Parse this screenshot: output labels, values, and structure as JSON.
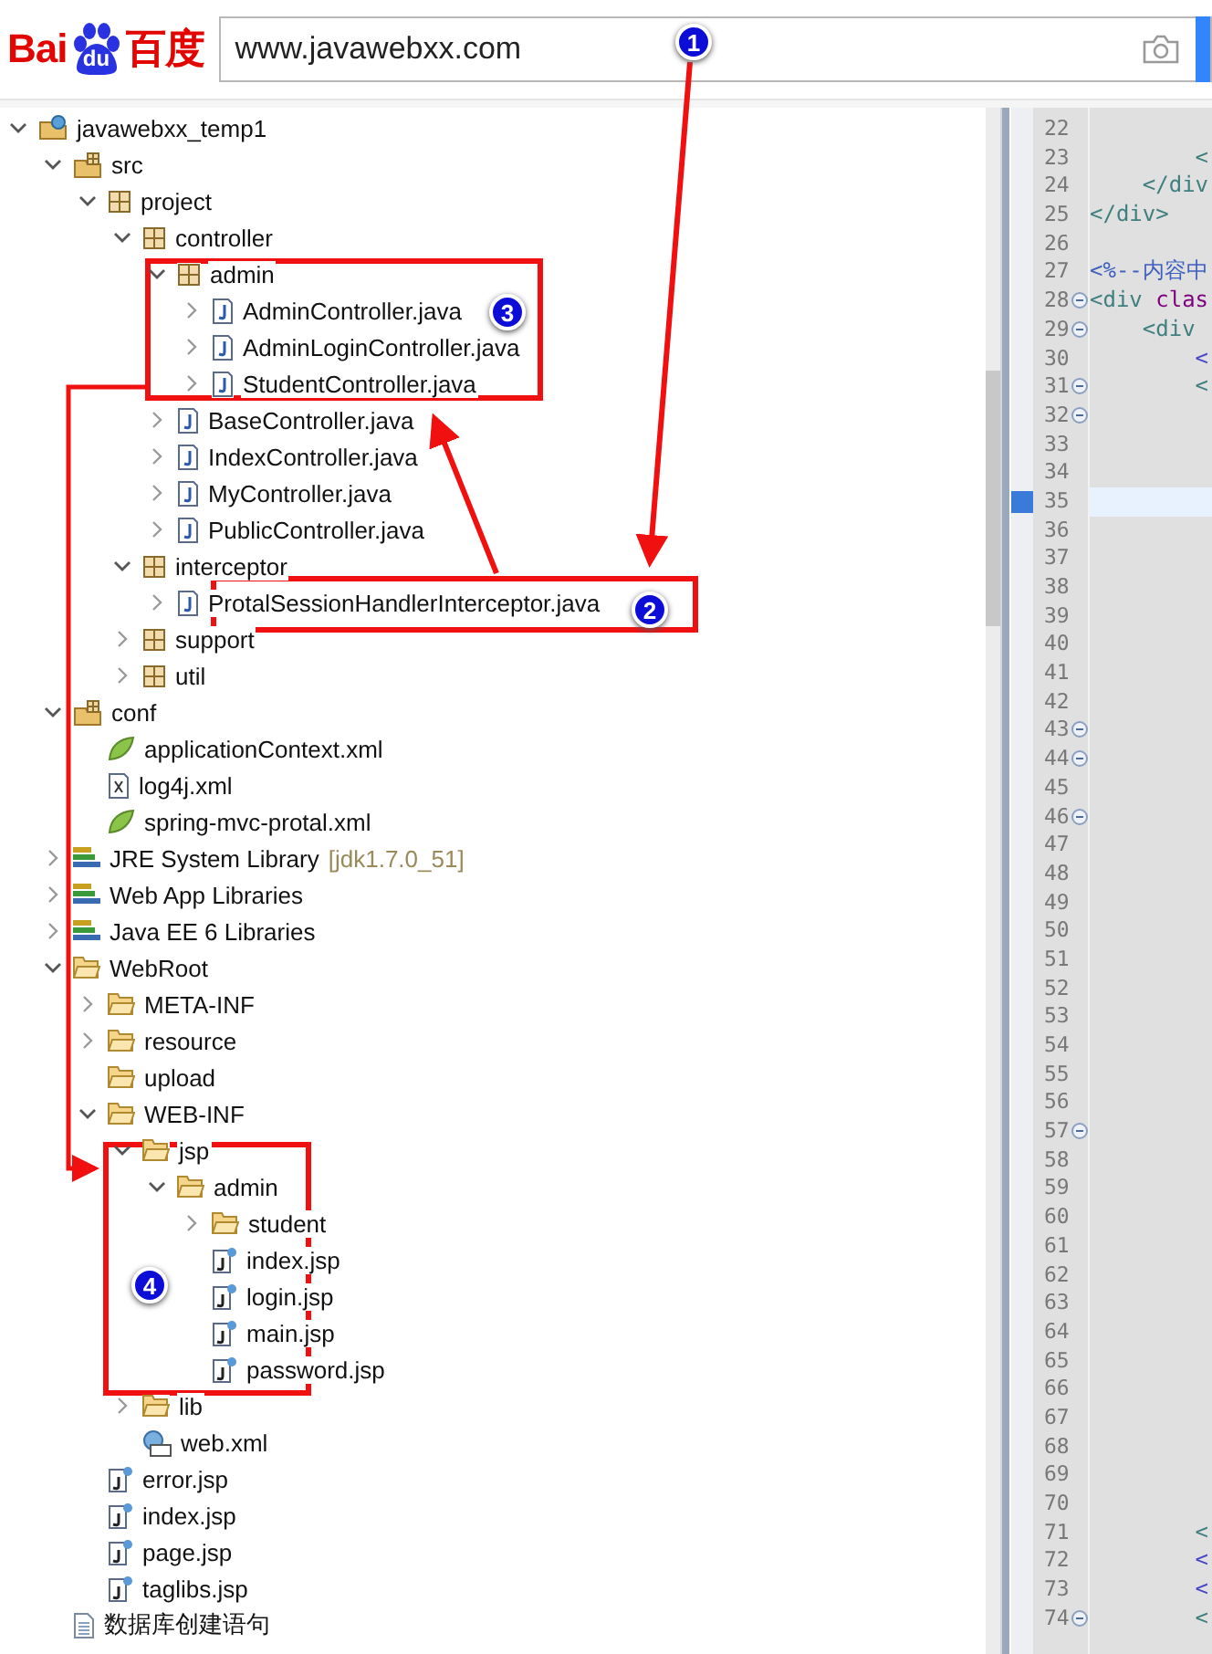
{
  "header": {
    "logo": {
      "left": "Bai",
      "badge": "du",
      "right": "百度"
    },
    "search": {
      "value": "www.javawebxx.com"
    }
  },
  "tree": [
    {
      "label": "javawebxx_temp1",
      "kind": "project",
      "expanded": true,
      "children": [
        {
          "label": "src",
          "kind": "source",
          "expanded": true,
          "children": [
            {
              "label": "project",
              "kind": "package",
              "expanded": true,
              "children": [
                {
                  "label": "controller",
                  "kind": "package",
                  "expanded": true,
                  "children": [
                    {
                      "label": "admin",
                      "kind": "package",
                      "expanded": true,
                      "children": [
                        {
                          "label": "AdminController.java",
                          "kind": "java",
                          "expanded": false
                        },
                        {
                          "label": "AdminLoginController.java",
                          "kind": "java",
                          "expanded": false
                        },
                        {
                          "label": "StudentController.java",
                          "kind": "java",
                          "expanded": false
                        }
                      ]
                    },
                    {
                      "label": "BaseController.java",
                      "kind": "java",
                      "expanded": false
                    },
                    {
                      "label": "IndexController.java",
                      "kind": "java",
                      "expanded": false
                    },
                    {
                      "label": "MyController.java",
                      "kind": "java",
                      "expanded": false
                    },
                    {
                      "label": "PublicController.java",
                      "kind": "java",
                      "expanded": false
                    }
                  ]
                },
                {
                  "label": "interceptor",
                  "kind": "package",
                  "expanded": true,
                  "children": [
                    {
                      "label": "ProtalSessionHandlerInterceptor.java",
                      "kind": "java",
                      "expanded": false
                    }
                  ]
                },
                {
                  "label": "support",
                  "kind": "package",
                  "expanded": false
                },
                {
                  "label": "util",
                  "kind": "package",
                  "expanded": false
                }
              ]
            }
          ]
        },
        {
          "label": "conf",
          "kind": "source",
          "expanded": true,
          "children": [
            {
              "label": "applicationContext.xml",
              "kind": "spring"
            },
            {
              "label": "log4j.xml",
              "kind": "xml"
            },
            {
              "label": "spring-mvc-protal.xml",
              "kind": "spring"
            }
          ]
        },
        {
          "label": "JRE System Library",
          "decoration": "[jdk1.7.0_51]",
          "kind": "library",
          "expanded": false
        },
        {
          "label": "Web App Libraries",
          "kind": "library",
          "expanded": false
        },
        {
          "label": "Java EE 6 Libraries",
          "kind": "library",
          "expanded": false
        },
        {
          "label": "WebRoot",
          "kind": "folder",
          "expanded": true,
          "children": [
            {
              "label": "META-INF",
              "kind": "folder",
              "expanded": false
            },
            {
              "label": "resource",
              "kind": "folder",
              "expanded": false
            },
            {
              "label": "upload",
              "kind": "folder"
            },
            {
              "label": "WEB-INF",
              "kind": "folder",
              "expanded": true,
              "children": [
                {
                  "label": "jsp",
                  "kind": "folder",
                  "expanded": true,
                  "children": [
                    {
                      "label": "admin",
                      "kind": "folder",
                      "expanded": true,
                      "children": [
                        {
                          "label": "student",
                          "kind": "folder",
                          "expanded": false
                        },
                        {
                          "label": "index.jsp",
                          "kind": "jsp"
                        },
                        {
                          "label": "login.jsp",
                          "kind": "jsp"
                        },
                        {
                          "label": "main.jsp",
                          "kind": "jsp"
                        },
                        {
                          "label": "password.jsp",
                          "kind": "jsp"
                        }
                      ]
                    }
                  ]
                },
                {
                  "label": "lib",
                  "kind": "folder",
                  "expanded": false
                },
                {
                  "label": "web.xml",
                  "kind": "webxml"
                }
              ]
            },
            {
              "label": "error.jsp",
              "kind": "jsp"
            },
            {
              "label": "index.jsp",
              "kind": "jsp"
            },
            {
              "label": "page.jsp",
              "kind": "jsp"
            },
            {
              "label": "taglibs.jsp",
              "kind": "jsp"
            }
          ]
        },
        {
          "label": "数据库创建语句",
          "kind": "file"
        }
      ]
    }
  ],
  "editor": {
    "lines": [
      {
        "number": "22",
        "fold": false,
        "current": false
      },
      {
        "number": "23",
        "fold": false,
        "current": false,
        "code": [
          {
            "text": "        <",
            "kind": "tag"
          }
        ]
      },
      {
        "number": "24",
        "fold": false,
        "current": false,
        "code": [
          {
            "text": "    </div",
            "kind": "tag"
          }
        ]
      },
      {
        "number": "25",
        "fold": false,
        "current": false,
        "code": [
          {
            "text": "</div>",
            "kind": "tag"
          }
        ]
      },
      {
        "number": "26",
        "fold": false,
        "current": false
      },
      {
        "number": "27",
        "fold": false,
        "current": false,
        "code": [
          {
            "text": "<%--内容中",
            "kind": "comment"
          }
        ]
      },
      {
        "number": "28",
        "fold": true,
        "current": false,
        "code": [
          {
            "text": "<div",
            "kind": "tag"
          },
          {
            "text": " clas",
            "kind": "attr"
          }
        ]
      },
      {
        "number": "29",
        "fold": true,
        "current": false,
        "code": [
          {
            "text": "    <div",
            "kind": "tag"
          }
        ]
      },
      {
        "number": "30",
        "fold": false,
        "current": false,
        "code": [
          {
            "text": "        <",
            "kind": "jsp"
          }
        ]
      },
      {
        "number": "31",
        "fold": true,
        "current": false,
        "code": [
          {
            "text": "        <",
            "kind": "tag"
          }
        ]
      },
      {
        "number": "32",
        "fold": true,
        "current": false
      },
      {
        "number": "33",
        "fold": false,
        "current": false
      },
      {
        "number": "34",
        "fold": false,
        "current": false
      },
      {
        "number": "35",
        "fold": false,
        "current": true
      },
      {
        "number": "36",
        "fold": false,
        "current": false
      },
      {
        "number": "37",
        "fold": false,
        "current": false
      },
      {
        "number": "38",
        "fold": false,
        "current": false
      },
      {
        "number": "39",
        "fold": false,
        "current": false
      },
      {
        "number": "40",
        "fold": false,
        "current": false
      },
      {
        "number": "41",
        "fold": false,
        "current": false
      },
      {
        "number": "42",
        "fold": false,
        "current": false
      },
      {
        "number": "43",
        "fold": true,
        "current": false
      },
      {
        "number": "44",
        "fold": true,
        "current": false
      },
      {
        "number": "45",
        "fold": false,
        "current": false
      },
      {
        "number": "46",
        "fold": true,
        "current": false
      },
      {
        "number": "47",
        "fold": false,
        "current": false
      },
      {
        "number": "48",
        "fold": false,
        "current": false
      },
      {
        "number": "49",
        "fold": false,
        "current": false
      },
      {
        "number": "50",
        "fold": false,
        "current": false
      },
      {
        "number": "51",
        "fold": false,
        "current": false
      },
      {
        "number": "52",
        "fold": false,
        "current": false
      },
      {
        "number": "53",
        "fold": false,
        "current": false
      },
      {
        "number": "54",
        "fold": false,
        "current": false
      },
      {
        "number": "55",
        "fold": false,
        "current": false
      },
      {
        "number": "56",
        "fold": false,
        "current": false
      },
      {
        "number": "57",
        "fold": true,
        "current": false
      },
      {
        "number": "58",
        "fold": false,
        "current": false
      },
      {
        "number": "59",
        "fold": false,
        "current": false
      },
      {
        "number": "60",
        "fold": false,
        "current": false
      },
      {
        "number": "61",
        "fold": false,
        "current": false
      },
      {
        "number": "62",
        "fold": false,
        "current": false
      },
      {
        "number": "63",
        "fold": false,
        "current": false
      },
      {
        "number": "64",
        "fold": false,
        "current": false
      },
      {
        "number": "65",
        "fold": false,
        "current": false
      },
      {
        "number": "66",
        "fold": false,
        "current": false
      },
      {
        "number": "67",
        "fold": false,
        "current": false
      },
      {
        "number": "68",
        "fold": false,
        "current": false
      },
      {
        "number": "69",
        "fold": false,
        "current": false
      },
      {
        "number": "70",
        "fold": false,
        "current": false
      },
      {
        "number": "71",
        "fold": false,
        "current": false,
        "code": [
          {
            "text": "        <",
            "kind": "tag"
          }
        ]
      },
      {
        "number": "72",
        "fold": false,
        "current": false,
        "code": [
          {
            "text": "        <",
            "kind": "jsp"
          }
        ]
      },
      {
        "number": "73",
        "fold": false,
        "current": false,
        "code": [
          {
            "text": "        <",
            "kind": "jsp"
          }
        ]
      },
      {
        "number": "74",
        "fold": true,
        "current": false,
        "code": [
          {
            "text": "        <",
            "kind": "tag"
          }
        ]
      }
    ]
  },
  "annotations": {
    "markers": [
      "1",
      "2",
      "3",
      "4"
    ]
  }
}
